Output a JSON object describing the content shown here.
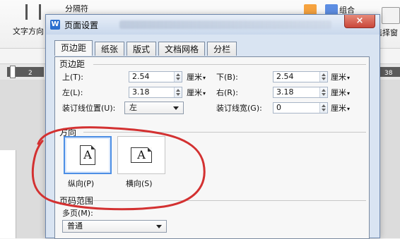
{
  "ribbon": {
    "left_label": "文字方向",
    "top_separator": "分隔符",
    "group_label": "组合",
    "right_label": "选择窗"
  },
  "ruler": {
    "left_number": "2",
    "right_number": "38"
  },
  "dialog": {
    "title": "页面设置",
    "tabs": [
      "页边距",
      "纸张",
      "版式",
      "文档网格",
      "分栏"
    ],
    "margins_title": "页边距",
    "fields": {
      "top": {
        "label": "上(T):",
        "value": "2.54",
        "unit": "厘米"
      },
      "bottom": {
        "label": "下(B):",
        "value": "2.54",
        "unit": "厘米"
      },
      "left": {
        "label": "左(L):",
        "value": "3.18",
        "unit": "厘米"
      },
      "right": {
        "label": "右(R):",
        "value": "3.18",
        "unit": "厘米"
      },
      "gutter_position": {
        "label": "装订线位置(U):",
        "value": "左"
      },
      "gutter_width": {
        "label": "装订线宽(G):",
        "value": "0",
        "unit": "厘米"
      }
    },
    "orientation_title": "方向",
    "orientation": {
      "portrait_label": "纵向(P)",
      "landscape_label": "横向(S)",
      "page_glyph": "A"
    },
    "page_range_title": "页码范围",
    "multiple_pages": {
      "label": "多页(M):",
      "value": "普通"
    }
  },
  "colors": {
    "dialog_bg": "#d9e4f2",
    "panel_bg": "#f7f7f7",
    "accent": "#4d8fe5",
    "annotation": "#d33131"
  }
}
